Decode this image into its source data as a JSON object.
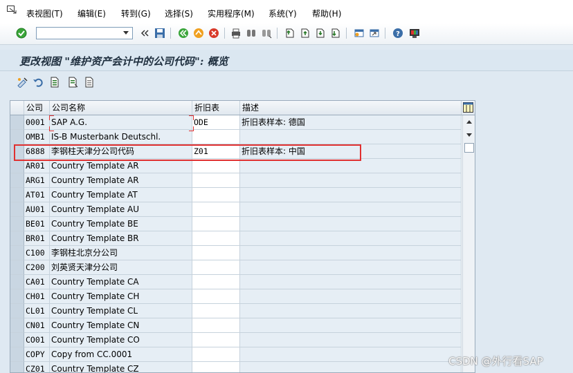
{
  "menu": [
    "表视图(T)",
    "编辑(E)",
    "转到(G)",
    "选择(S)",
    "实用程序(M)",
    "系统(Y)",
    "帮助(H)"
  ],
  "command_field": {
    "value": ""
  },
  "title": "更改视图 \"维护资产会计中的公司代码\": 概览",
  "table": {
    "headers": {
      "code": "公司",
      "name": "公司名称",
      "dep": "折旧表",
      "desc": "描述"
    },
    "rows": [
      {
        "code": "0001",
        "name": "SAP A.G.",
        "dep": "ODE",
        "desc": "折旧表样本: 德国"
      },
      {
        "code": "OMB1",
        "name": "IS-B Musterbank Deutschl.",
        "dep": "",
        "desc": ""
      },
      {
        "code": "6888",
        "name": "李钢柱天津分公司代码",
        "dep": "Z01",
        "desc": "折旧表样本: 中国"
      },
      {
        "code": "AR01",
        "name": "Country Template AR",
        "dep": "",
        "desc": ""
      },
      {
        "code": "ARG1",
        "name": "Country Template AR",
        "dep": "",
        "desc": ""
      },
      {
        "code": "AT01",
        "name": "Country Template AT",
        "dep": "",
        "desc": ""
      },
      {
        "code": "AU01",
        "name": "Country Template AU",
        "dep": "",
        "desc": ""
      },
      {
        "code": "BE01",
        "name": "Country Template BE",
        "dep": "",
        "desc": ""
      },
      {
        "code": "BR01",
        "name": "Country Template BR",
        "dep": "",
        "desc": ""
      },
      {
        "code": "C100",
        "name": "李钢柱北京分公司",
        "dep": "",
        "desc": ""
      },
      {
        "code": "C200",
        "name": "刘英贤天津分公司",
        "dep": "",
        "desc": ""
      },
      {
        "code": "CA01",
        "name": "Country Template CA",
        "dep": "",
        "desc": ""
      },
      {
        "code": "CH01",
        "name": "Country Template CH",
        "dep": "",
        "desc": ""
      },
      {
        "code": "CL01",
        "name": "Country Template CL",
        "dep": "",
        "desc": ""
      },
      {
        "code": "CN01",
        "name": "Country Template CN",
        "dep": "",
        "desc": ""
      },
      {
        "code": "CO01",
        "name": "Country Template CO",
        "dep": "",
        "desc": ""
      },
      {
        "code": "COPY",
        "name": "Copy from CC.0001",
        "dep": "",
        "desc": ""
      },
      {
        "code": "CZ01",
        "name": "Country Template CZ",
        "dep": "",
        "desc": ""
      }
    ]
  },
  "watermark": "CSDN @外行看SAP",
  "colors": {
    "highlight": "#e03030",
    "title_bg": "#dbe7f1",
    "key_cell": "#e6eef5"
  }
}
